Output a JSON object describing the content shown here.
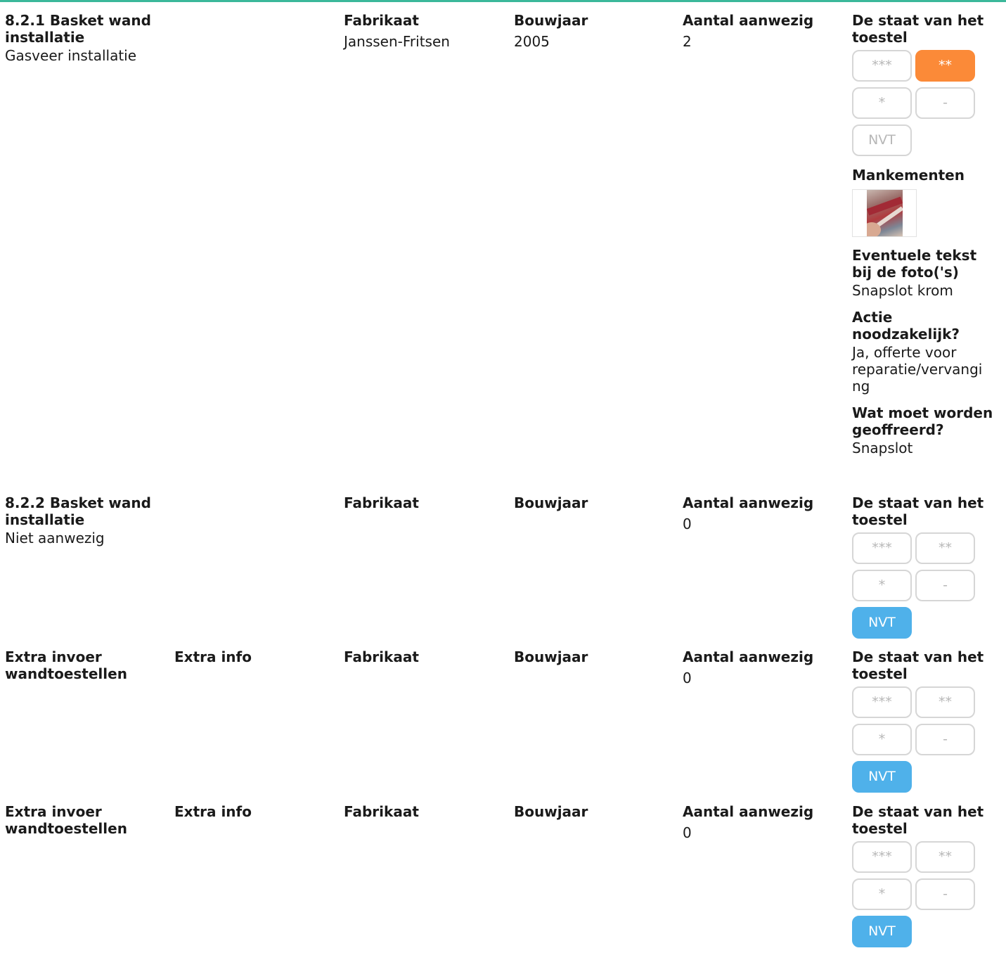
{
  "labels": {
    "fabrikaat": "Fabrikaat",
    "bouwjaar": "Bouwjaar",
    "aantal": "Aantal aanwezig",
    "staat": "De staat van het toestel",
    "extra_info": "Extra info",
    "mankementen": "Mankementen",
    "foto_tekst": "Eventuele tekst bij de foto('s)",
    "actie": "Actie noodzakelijk?",
    "offreren": "Wat moet worden geoffreerd?"
  },
  "rating_options": [
    "***",
    "**",
    "*",
    "-",
    "NVT"
  ],
  "colors": {
    "accent_line": "#3bb89a",
    "selected_orange": "#fb8a38",
    "selected_blue": "#4fb1ea"
  },
  "items": [
    {
      "title": "8.2.1 Basket wand installatie",
      "subtitle": "Gasveer installatie",
      "fabrikaat": "Janssen-Fritsen",
      "bouwjaar": "2005",
      "aantal": "2",
      "selected_rating": "**",
      "mankementen_photo_icon": "photo-thumbnail",
      "foto_tekst": "Snapslot krom",
      "actie": "Ja, offerte voor reparatie/vervangi ng",
      "offreren": "Snapslot"
    },
    {
      "title": "8.2.2 Basket wand installatie",
      "subtitle": "Niet aanwezig",
      "fabrikaat": "",
      "bouwjaar": "",
      "aantal": "0",
      "selected_rating": "NVT"
    },
    {
      "title": "Extra invoer wandtoestellen",
      "extra_info": "",
      "fabrikaat": "",
      "bouwjaar": "",
      "aantal": "0",
      "selected_rating": "NVT"
    },
    {
      "title": "Extra invoer wandtoestellen",
      "extra_info": "",
      "fabrikaat": "",
      "bouwjaar": "",
      "aantal": "0",
      "selected_rating": "NVT"
    }
  ]
}
